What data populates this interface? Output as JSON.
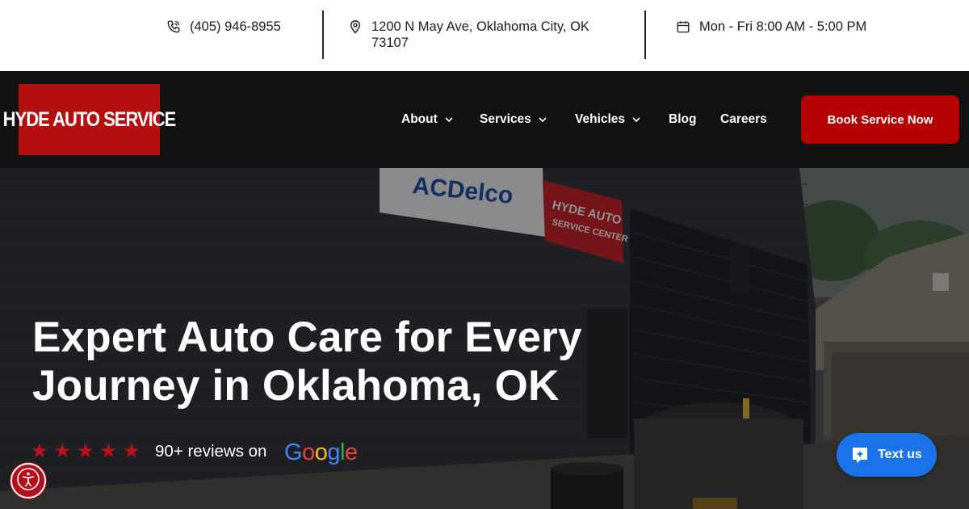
{
  "topbar": {
    "phone": "(405) 946-8955",
    "address": "1200 N May Ave, Oklahoma City, OK 73107",
    "hours": "Mon - Fri 8:00 AM - 5:00 PM"
  },
  "nav": {
    "logo_text": "HYDE AUTO SERVICE",
    "items": [
      {
        "label": "About",
        "has_dropdown": true
      },
      {
        "label": "Services",
        "has_dropdown": true
      },
      {
        "label": "Vehicles",
        "has_dropdown": true
      },
      {
        "label": "Blog",
        "has_dropdown": false
      },
      {
        "label": "Careers",
        "has_dropdown": false
      }
    ],
    "cta_label": "Book Service Now"
  },
  "hero": {
    "headline": "Expert Auto Care for Every Journey in Oklahoma, OK",
    "rating_stars": 5,
    "reviews_text": "90+ reviews on",
    "google_letters": [
      "G",
      "o",
      "o",
      "g",
      "l",
      "e"
    ],
    "sign_text_1": "HYDE AUTO",
    "sign_text_2": "SERVICE CENTER",
    "sign_brand": "ACDelco"
  },
  "widgets": {
    "text_us_label": "Text us"
  },
  "colors": {
    "brand_red": "#b40f0f",
    "cta_red": "#b50000",
    "star_red": "#c0111b",
    "nav_bg": "#111111",
    "chat_blue": "#1a73e8"
  },
  "icons": {
    "phone": "phone-icon",
    "address": "map-pin-icon",
    "hours": "calendar-icon",
    "dropdown": "chevron-down-icon",
    "chat": "chat-bubble-icon",
    "accessibility": "accessibility-icon"
  }
}
